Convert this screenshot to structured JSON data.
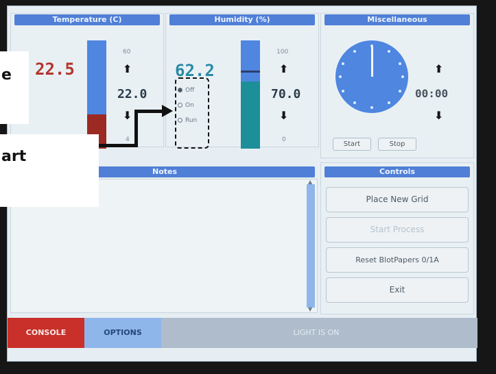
{
  "panels": {
    "temperature": {
      "title": "Temperature (C)",
      "current": "22.5",
      "max_label": "60",
      "setpoint": "22.0",
      "min_label": "4",
      "level_fraction": 0.32
    },
    "humidity": {
      "title": "Humidity (%)",
      "current": "62.2",
      "max_label": "100",
      "setpoint": "70.0",
      "min_label": "0",
      "level_fraction": 0.62,
      "modes": [
        "Off",
        "On",
        "Run"
      ]
    },
    "misc": {
      "title": "Miscellaneous",
      "timer": "00:00",
      "start_label": "Start",
      "stop_label": "Stop"
    },
    "notes": {
      "title": "Notes"
    },
    "controls": {
      "title": "Controls",
      "buttons": [
        "Place New Grid",
        "Start Process",
        "Reset BlotPapers 0/1A",
        "Exit"
      ]
    }
  },
  "bottom": {
    "console_label": "CONSOLE",
    "options_label": "OPTIONS",
    "status_text": "LIGHT IS ON"
  },
  "annotations": {
    "top_box": "e",
    "bottom_box": "art"
  },
  "colors": {
    "header_blue": "#4f7fd6",
    "bar_blue": "#4e86e0",
    "temp_red": "#9b2a22",
    "humidity_teal": "#1d8f99",
    "console_red": "#c9302a"
  }
}
